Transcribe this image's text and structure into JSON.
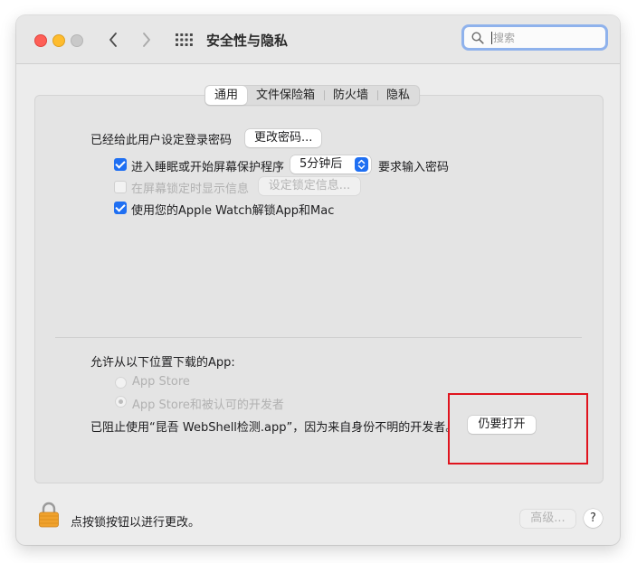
{
  "window": {
    "title": "安全性与隐私",
    "search_placeholder": "搜索"
  },
  "tabs": [
    {
      "label": "通用",
      "active": true
    },
    {
      "label": "文件保险箱",
      "active": false
    },
    {
      "label": "防火墙",
      "active": false
    },
    {
      "label": "隐私",
      "active": false
    }
  ],
  "general": {
    "login_password_label": "已经给此用户设定登录密码",
    "change_password_button": "更改密码...",
    "require_password": {
      "checked": true,
      "prefix": "进入睡眠或开始屏幕保护程序",
      "delay_value": "5分钟后",
      "suffix": "要求输入密码"
    },
    "lock_message": {
      "checked": false,
      "enabled": false,
      "label": "在屏幕锁定时显示信息",
      "button": "设定锁定信息..."
    },
    "apple_watch": {
      "checked": true,
      "label": "使用您的Apple Watch解锁App和Mac"
    }
  },
  "downloads": {
    "heading": "允许从以下位置下载的App:",
    "options": [
      {
        "label": "App Store",
        "selected": false
      },
      {
        "label": "App Store和被认可的开发者",
        "selected": true
      }
    ],
    "blocked_message": "已阻止使用“昆吾 WebShell检测.app”，因为来自身份不明的开发者。",
    "open_anyway_button": "仍要打开"
  },
  "footer": {
    "lock_text": "点按锁按钮以进行更改。",
    "advanced_button": "高级...",
    "help_label": "?"
  },
  "colors": {
    "accent": "#1f6ff2",
    "highlight_box": "#e0141e"
  }
}
